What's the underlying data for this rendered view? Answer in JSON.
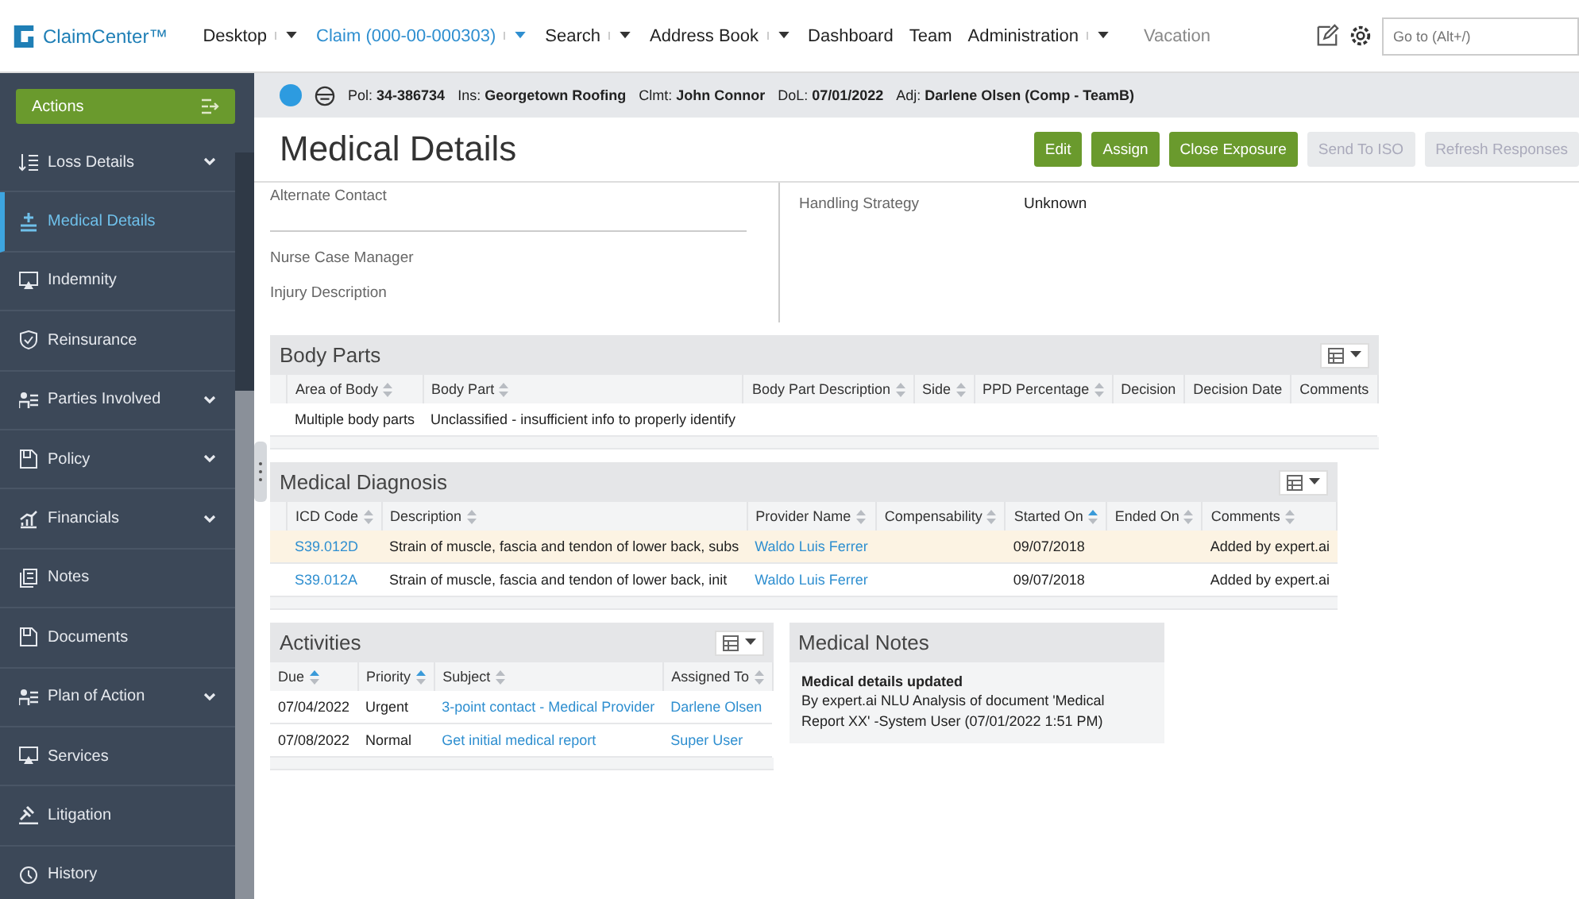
{
  "app": {
    "name": "ClaimCenter™"
  },
  "nav": [
    {
      "label": "Desktop",
      "dropdown": true,
      "active": false,
      "disabled": false
    },
    {
      "label": "Claim (000-00-000303)",
      "dropdown": true,
      "active": true,
      "disabled": false
    },
    {
      "label": "Search",
      "dropdown": true,
      "active": false,
      "disabled": false
    },
    {
      "label": "Address Book",
      "dropdown": true,
      "active": false,
      "disabled": false
    },
    {
      "label": "Dashboard",
      "dropdown": false,
      "active": false,
      "disabled": false
    },
    {
      "label": "Team",
      "dropdown": false,
      "active": false,
      "disabled": false
    },
    {
      "label": "Administration",
      "dropdown": true,
      "active": false,
      "disabled": false
    },
    {
      "label": "Vacation",
      "dropdown": false,
      "active": false,
      "disabled": true
    }
  ],
  "goto": {
    "placeholder": "Go to (Alt+/)"
  },
  "actions": {
    "label": "Actions"
  },
  "sidebar": {
    "items": [
      {
        "label": "Loss Details",
        "expandable": true,
        "selected": false
      },
      {
        "label": "Medical Details",
        "expandable": false,
        "selected": true
      },
      {
        "label": "Indemnity",
        "expandable": false,
        "selected": false
      },
      {
        "label": "Reinsurance",
        "expandable": false,
        "selected": false
      },
      {
        "label": "Parties Involved",
        "expandable": true,
        "selected": false
      },
      {
        "label": "Policy",
        "expandable": true,
        "selected": false
      },
      {
        "label": "Financials",
        "expandable": true,
        "selected": false
      },
      {
        "label": "Notes",
        "expandable": false,
        "selected": false
      },
      {
        "label": "Documents",
        "expandable": false,
        "selected": false
      },
      {
        "label": "Plan of Action",
        "expandable": true,
        "selected": false
      },
      {
        "label": "Services",
        "expandable": false,
        "selected": false
      },
      {
        "label": "Litigation",
        "expandable": false,
        "selected": false
      },
      {
        "label": "History",
        "expandable": false,
        "selected": false
      }
    ]
  },
  "info_bar": [
    "Pol: **34-386734**",
    "Ins: **Georgetown Roofing**",
    "Clmt: **John Connor**",
    "DoL: **07/01/2022**",
    "Adj: **Darlene Olsen (Comp - TeamB)**"
  ],
  "page": {
    "title": "Medical Details",
    "buttons": [
      {
        "label": "Edit",
        "disabled": false
      },
      {
        "label": "Assign",
        "disabled": false
      },
      {
        "label": "Close Exposure",
        "disabled": false
      },
      {
        "label": "Send To ISO",
        "disabled": true
      },
      {
        "label": "Refresh Responses",
        "disabled": true
      }
    ]
  },
  "details": {
    "left": [
      {
        "label": "Alternate Contact",
        "divider": true
      },
      {
        "label": "Nurse Case Manager",
        "divider": false
      },
      {
        "label": "Injury Description",
        "divider": false
      }
    ],
    "right": [
      {
        "label": "Handling Strategy",
        "value": "Unknown"
      }
    ]
  },
  "body_parts": {
    "title": "Body Parts",
    "columns": [
      {
        "label": "Area of Body",
        "sortable": true,
        "sorted": false
      },
      {
        "label": "Body Part",
        "sortable": true,
        "sorted": false
      },
      {
        "label": "Body Part Description",
        "sortable": true,
        "sorted": false
      },
      {
        "label": "Side",
        "sortable": true,
        "sorted": false
      },
      {
        "label": "PPD Percentage",
        "sortable": true,
        "sorted": false
      },
      {
        "label": "Decision",
        "sortable": false,
        "sorted": false
      },
      {
        "label": "Decision Date",
        "sortable": false,
        "sorted": false
      },
      {
        "label": "Comments",
        "sortable": false,
        "sorted": false
      }
    ],
    "rows": [
      {
        "selected": false,
        "cells": [
          {
            "text": "Multiple body parts",
            "kind": "text"
          },
          {
            "text": "Unclassified - insufficient info to properly identify",
            "kind": "text"
          },
          {
            "kind": "blank"
          },
          {
            "kind": "blank"
          },
          {
            "kind": "blank"
          },
          {
            "kind": "blank"
          },
          {
            "kind": "blank"
          },
          {
            "kind": "blank"
          }
        ]
      }
    ]
  },
  "diagnosis": {
    "title": "Medical Diagnosis",
    "columns": [
      {
        "label": "ICD Code",
        "sortable": true,
        "sorted": false
      },
      {
        "label": "Description",
        "sortable": true,
        "sorted": false
      },
      {
        "label": "Provider Name",
        "sortable": true,
        "sorted": false
      },
      {
        "label": "Compensability",
        "sortable": true,
        "sorted": false
      },
      {
        "label": "Started On",
        "sortable": true,
        "sorted": true
      },
      {
        "label": "Ended On",
        "sortable": true,
        "sorted": false
      },
      {
        "label": "Comments",
        "sortable": true,
        "sorted": false
      }
    ],
    "rows": [
      {
        "selected": true,
        "cells": [
          {
            "text": "S39.012D",
            "kind": "link"
          },
          {
            "text": "Strain of muscle, fascia and tendon of lower back, subs",
            "kind": "text"
          },
          {
            "text": "Waldo Luis Ferrer",
            "kind": "link"
          },
          {
            "kind": "blank"
          },
          {
            "text": "09/07/2018",
            "kind": "text"
          },
          {
            "kind": "blank"
          },
          {
            "text": "Added by expert.ai",
            "kind": "text"
          }
        ]
      },
      {
        "selected": false,
        "cells": [
          {
            "text": "S39.012A",
            "kind": "link"
          },
          {
            "text": "Strain of muscle, fascia and tendon of lower back, init",
            "kind": "text"
          },
          {
            "text": "Waldo Luis Ferrer",
            "kind": "link"
          },
          {
            "kind": "blank"
          },
          {
            "text": "09/07/2018",
            "kind": "text"
          },
          {
            "kind": "blank"
          },
          {
            "text": "Added by expert.ai",
            "kind": "text"
          }
        ]
      }
    ]
  },
  "activities": {
    "title": "Activities",
    "columns": [
      {
        "label": "Due",
        "sortable": true,
        "sorted": true
      },
      {
        "label": "Priority",
        "sortable": true,
        "sorted": true
      },
      {
        "label": "Subject",
        "sortable": true,
        "sorted": false
      },
      {
        "label": "Assigned To",
        "sortable": true,
        "sorted": false
      }
    ],
    "rows": [
      {
        "selected": false,
        "cells": [
          {
            "text": "07/04/2022",
            "kind": "text"
          },
          {
            "text": "Urgent",
            "kind": "text"
          },
          {
            "text": "3-point contact - Medical Provider",
            "kind": "link"
          },
          {
            "text": "Darlene Olsen",
            "kind": "link"
          }
        ]
      },
      {
        "selected": false,
        "cells": [
          {
            "text": "07/08/2022",
            "kind": "text"
          },
          {
            "text": "Normal",
            "kind": "text"
          },
          {
            "text": "Get initial medical report",
            "kind": "link"
          },
          {
            "text": "Super User",
            "kind": "link"
          }
        ]
      }
    ]
  },
  "medical_notes": {
    "title": "Medical Notes",
    "heading": "Medical details updated",
    "body": "By expert.ai NLU Analysis of document 'Medical Report XX' -System User (07/01/2022 1:51 PM)"
  }
}
